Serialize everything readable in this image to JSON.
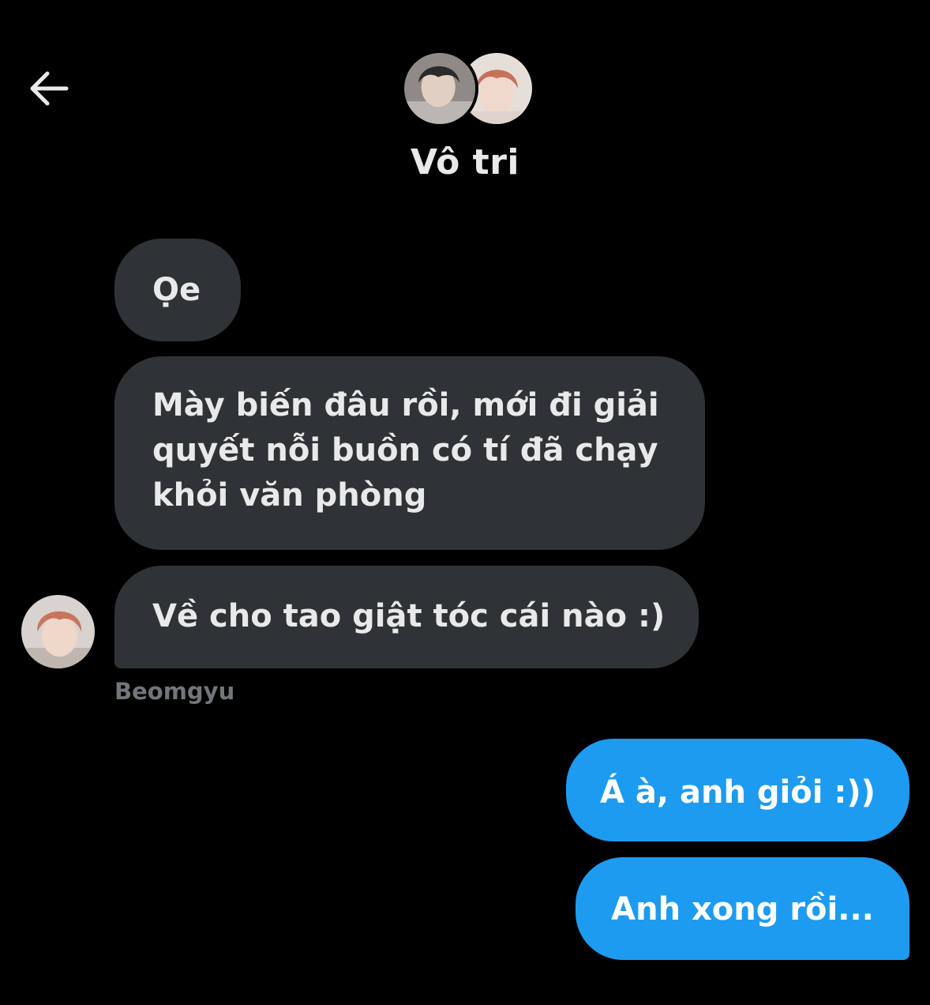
{
  "header": {
    "back_icon": "arrow-left-icon",
    "title": "Vô tri",
    "avatars": [
      "group-member-avatar-1",
      "group-member-avatar-2"
    ]
  },
  "messages": [
    {
      "direction": "incoming",
      "text": "Ọe"
    },
    {
      "direction": "incoming",
      "text": "Mày biến đâu rồi, mới đi giải\nquyết nỗi buồn có tí đã chạy\nkhỏi văn phòng"
    },
    {
      "direction": "incoming",
      "text": "Về cho tao giật tóc cái nào :)",
      "sender": "Beomgyu"
    },
    {
      "direction": "outgoing",
      "text": "Á à, anh giỏi :))"
    },
    {
      "direction": "outgoing",
      "text": "Anh xong rồi..."
    }
  ],
  "colors": {
    "background": "#000000",
    "incoming_bubble": "#2f3336",
    "outgoing_bubble": "#1d9bf0",
    "sender_name": "#71767b"
  }
}
